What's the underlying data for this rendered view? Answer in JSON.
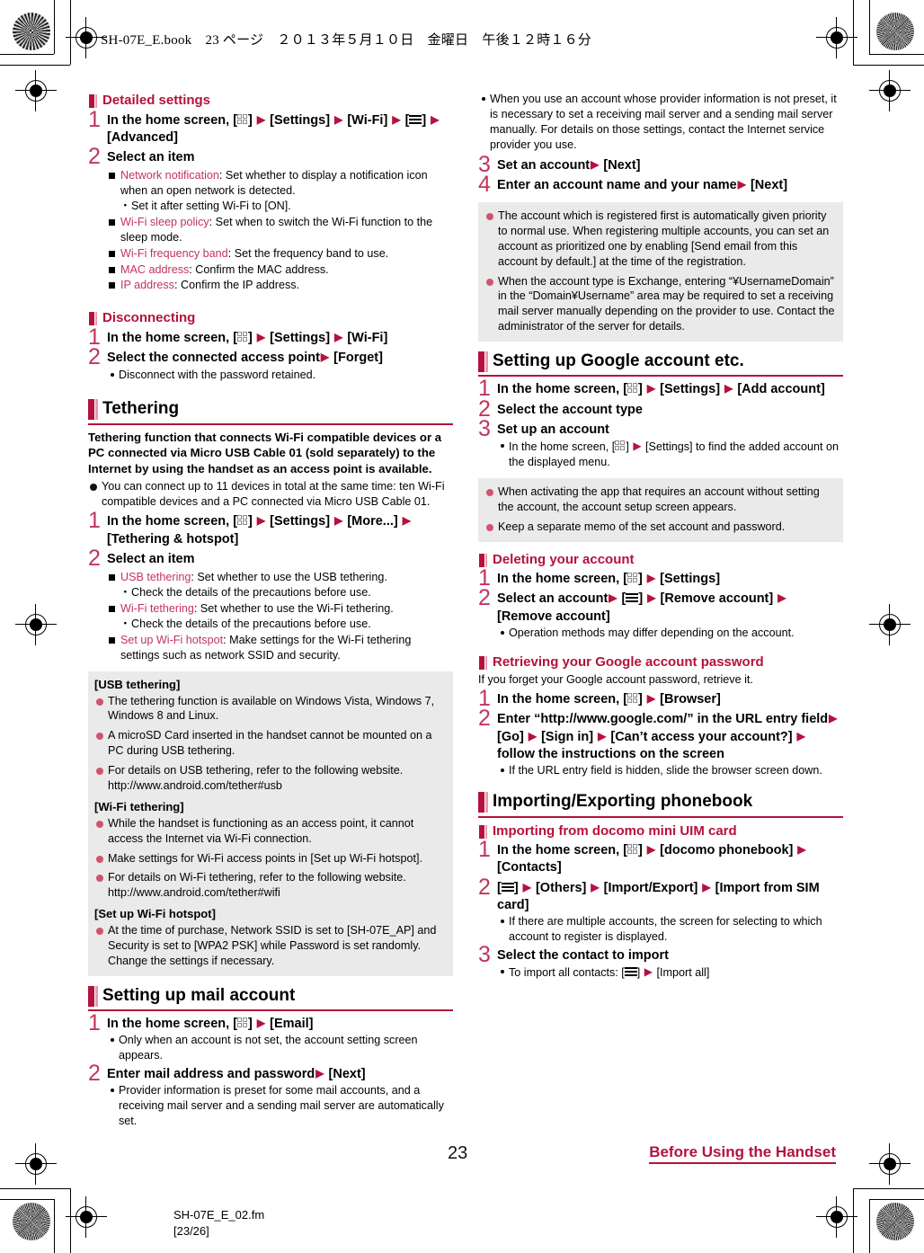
{
  "header": {
    "text": "SH-07E_E.book　23 ページ　２０１３年５月１０日　金曜日　午後１２時１６分"
  },
  "footer": {
    "page_number": "23",
    "chapter_tag": "Before Using the Handset",
    "file_name": "SH-07E_E_02.fm",
    "file_pages": "[23/26]"
  },
  "colors": {
    "accent": "#b4123c",
    "accent_light": "#c1355c",
    "keyword": "#c1355c",
    "notebox_bg": "#eaeaea"
  },
  "left_column": {
    "detailed_settings": {
      "heading": "Detailed settings",
      "step1_num": "1",
      "step1_a": "In the home screen, [",
      "step1_b": "] ",
      "step1_c": " [Settings] ",
      "step1_d": " [Wi-Fi] ",
      "step1_e": " [",
      "step1_f": "] ",
      "step1_g": " [Advanced]",
      "step2_num": "2",
      "step2_text": "Select an item",
      "items": [
        {
          "kw": "Network notification",
          "desc": ": Set whether to display a notification icon when an open network is detected.",
          "sub": "Set it after setting Wi-Fi to [ON]."
        },
        {
          "kw": "Wi-Fi sleep policy",
          "desc": ": Set when to switch the Wi-Fi function to the sleep mode."
        },
        {
          "kw": "Wi-Fi frequency band",
          "desc": ": Set the frequency band to use."
        },
        {
          "kw": "MAC address",
          "desc": ": Confirm the MAC address."
        },
        {
          "kw": "IP address",
          "desc": ": Confirm the IP address."
        }
      ]
    },
    "disconnecting": {
      "heading": "Disconnecting",
      "step1_num": "1",
      "step1_a": "In the home screen, [",
      "step1_b": "] ",
      "step1_c": " [Settings] ",
      "step1_d": " [Wi-Fi]",
      "step2_num": "2",
      "step2_a": "Select the connected access point",
      "step2_b": " [Forget]",
      "note": "Disconnect with the password retained."
    },
    "tethering": {
      "heading": "Tethering",
      "intro": "Tethering function that connects Wi-Fi compatible devices or a PC connected via Micro USB Cable 01 (sold separately) to the Internet by using the handset as an access point is available.",
      "bullet": "You can connect up to 11 devices in total at the same time: ten Wi-Fi compatible devices and a PC connected via Micro USB Cable 01.",
      "step1_num": "1",
      "step1_a": "In the home screen, [",
      "step1_b": "] ",
      "step1_c": " [Settings] ",
      "step1_d": " [More...] ",
      "step1_e": " [Tethering & hotspot]",
      "step2_num": "2",
      "step2_text": "Select an item",
      "items": [
        {
          "kw": "USB tethering",
          "desc": ": Set whether to use the USB tethering.",
          "sub": "Check the details of the precautions before use."
        },
        {
          "kw": "Wi-Fi tethering",
          "desc": ": Set whether to use the Wi-Fi tethering.",
          "sub": "Check the details of the precautions before use."
        },
        {
          "kw": "Set up Wi-Fi hotspot",
          "desc": ": Make settings for the Wi-Fi tethering settings such as network SSID and security."
        }
      ],
      "notebox": {
        "usb_head": "[USB tethering]",
        "usb_items": [
          "The tethering function is available on Windows Vista, Windows 7, Windows 8 and Linux.",
          "A microSD Card inserted in the handset cannot be mounted on a PC during USB tethering.",
          "For details on USB tethering, refer to the following website. http://www.android.com/tether#usb"
        ],
        "wifi_head": "[Wi-Fi tethering]",
        "wifi_items": [
          "While the handset is functioning as an access point, it cannot access the Internet via Wi-Fi connection.",
          "Make settings for Wi-Fi access points in [Set up Wi-Fi hotspot].",
          "For details on Wi-Fi tethering, refer to the following website. http://www.android.com/tether#wifi"
        ],
        "hotspot_head": "[Set up Wi-Fi hotspot]",
        "hotspot_items": [
          "At the time of purchase, Network SSID is set to [SH-07E_AP] and Security is set to [WPA2 PSK] while Password is set randomly. Change the settings if necessary."
        ]
      }
    },
    "mail_account": {
      "heading": "Setting up mail account",
      "step1_num": "1",
      "step1_a": "In the home screen, [",
      "step1_b": "] ",
      "step1_c": " [Email]",
      "step1_note": "Only when an account is not set, the account setting screen appears.",
      "step2_num": "2",
      "step2_a": "Enter mail address and password",
      "step2_b": " [Next]",
      "step2_note": "Provider information is preset for some mail accounts, and a receiving mail server and a sending mail server are automatically set."
    }
  },
  "right_column": {
    "mail_account_cont": {
      "note": "When you use an account whose provider information is not preset, it is necessary to set a receiving mail server and a sending mail server manually. For details on those settings, contact the Internet service provider you use.",
      "step3_num": "3",
      "step3_a": "Set an account",
      "step3_b": " [Next]",
      "step4_num": "4",
      "step4_a": "Enter an account name and your name",
      "step4_b": " [Next]",
      "notebox_items": [
        "The account which is registered first is automatically given priority to normal use. When registering multiple accounts, you can set an account as prioritized one by enabling [Send email from this account by default.] at the time of the registration.",
        "When the account type is Exchange, entering “¥UsernameDomain” in the “Domain¥Username” area may be required to set a receiving mail server manually depending on the provider to use. Contact the administrator of the server for details."
      ]
    },
    "google_account": {
      "heading": "Setting up Google account etc.",
      "step1_num": "1",
      "step1_a": "In the home screen, [",
      "step1_b": "] ",
      "step1_c": " [Settings] ",
      "step1_d": " [Add account]",
      "step2_num": "2",
      "step2_text": "Select the account type",
      "step3_num": "3",
      "step3_text": "Set up an account",
      "step3_note_a": "In the home screen, [",
      "step3_note_b": "] ",
      "step3_note_c": " [Settings] to find the added account on the displayed menu.",
      "notebox_items": [
        "When activating the app that requires an account without setting the account, the account setup screen appears.",
        "Keep a separate memo of the set account and password."
      ]
    },
    "deleting_account": {
      "heading": "Deleting your account",
      "step1_num": "1",
      "step1_a": "In the home screen, [",
      "step1_b": "] ",
      "step1_c": " [Settings]",
      "step2_num": "2",
      "step2_a": "Select an account",
      "step2_b": " [",
      "step2_c": "] ",
      "step2_d": " [Remove account] ",
      "step2_e": " [Remove account]",
      "note": "Operation methods may differ depending on the account."
    },
    "retrieving_password": {
      "heading": "Retrieving your Google account password",
      "intro": "If you forget your Google account password, retrieve it.",
      "step1_num": "1",
      "step1_a": "In the home screen, [",
      "step1_b": "] ",
      "step1_c": " [Browser]",
      "step2_num": "2",
      "step2_a": "Enter “http://www.google.com/” in the URL entry field",
      "step2_b": " [Go] ",
      "step2_c": " [Sign in] ",
      "step2_d": " [Can’t access your account?] ",
      "step2_e": " follow the instructions on the screen",
      "note": "If the URL entry field is hidden, slide the browser screen down."
    },
    "phonebook": {
      "heading": "Importing/Exporting phonebook",
      "sub_heading": "Importing from docomo mini UIM card",
      "step1_num": "1",
      "step1_a": "In the home screen, [",
      "step1_b": "] ",
      "step1_c": " [docomo phonebook] ",
      "step1_d": " [Contacts]",
      "step2_num": "2",
      "step2_a": "[",
      "step2_b": "] ",
      "step2_c": " [Others] ",
      "step2_d": " [Import/Export] ",
      "step2_e": " [Import from SIM card]",
      "step2_note": "If there are multiple accounts, the screen for selecting to which account to register is displayed.",
      "step3_num": "3",
      "step3_text": "Select the contact to import",
      "step3_note_a": "To import all contacts: [",
      "step3_note_b": "] ",
      "step3_note_c": " [Import all]"
    }
  }
}
